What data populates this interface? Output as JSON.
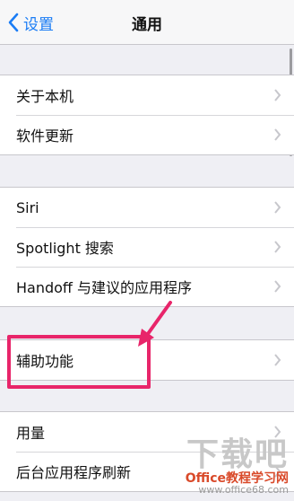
{
  "navbar": {
    "back_label": "设置",
    "title": "通用"
  },
  "groups": [
    {
      "items": [
        {
          "label": "关于本机"
        },
        {
          "label": "软件更新"
        }
      ]
    },
    {
      "items": [
        {
          "label": "Siri"
        },
        {
          "label": "Spotlight 搜索"
        },
        {
          "label": "Handoff 与建议的应用程序"
        }
      ]
    },
    {
      "items": [
        {
          "label": "辅助功能"
        }
      ]
    },
    {
      "items": [
        {
          "label": "用量"
        },
        {
          "label": "后台应用程序刷新"
        }
      ]
    }
  ],
  "watermark": {
    "big": "下载吧",
    "site": "Office教程学习网",
    "url": "www.office68.com"
  },
  "colors": {
    "accent": "#1a7cf5",
    "highlight": "#e8256a"
  }
}
